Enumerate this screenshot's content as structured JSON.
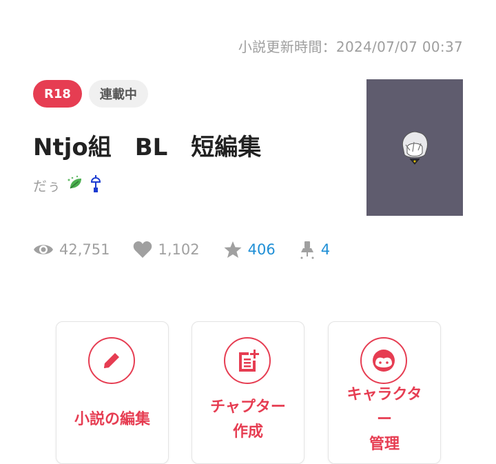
{
  "header": {
    "updated_label": "小説更新時間：2024/07/07 00:37"
  },
  "novel": {
    "badges": {
      "rating": "R18",
      "status": "連載中"
    },
    "title": "Ntjo組　BL　短編集",
    "author": "だぅ"
  },
  "stats": {
    "views": "42,751",
    "likes": "1,102",
    "stars": "406",
    "bookmarks": "4"
  },
  "actions": [
    {
      "lines": [
        "小説の編集"
      ]
    },
    {
      "lines": [
        "チャプター",
        "作成"
      ]
    },
    {
      "lines": [
        "キャラクタ",
        "ー",
        "管理"
      ]
    }
  ],
  "colors": {
    "accent": "#e63d52",
    "link_blue": "#1f8fd6",
    "muted": "#9e9e9e",
    "cover_bg": "#5f5c6e"
  },
  "icons": {
    "views": "eye-icon",
    "likes": "heart-icon",
    "stars": "star-icon",
    "bookmarks": "bookmark-pin-icon",
    "edit": "pencil-icon",
    "chapter": "add-document-icon",
    "character": "character-face-icon"
  }
}
